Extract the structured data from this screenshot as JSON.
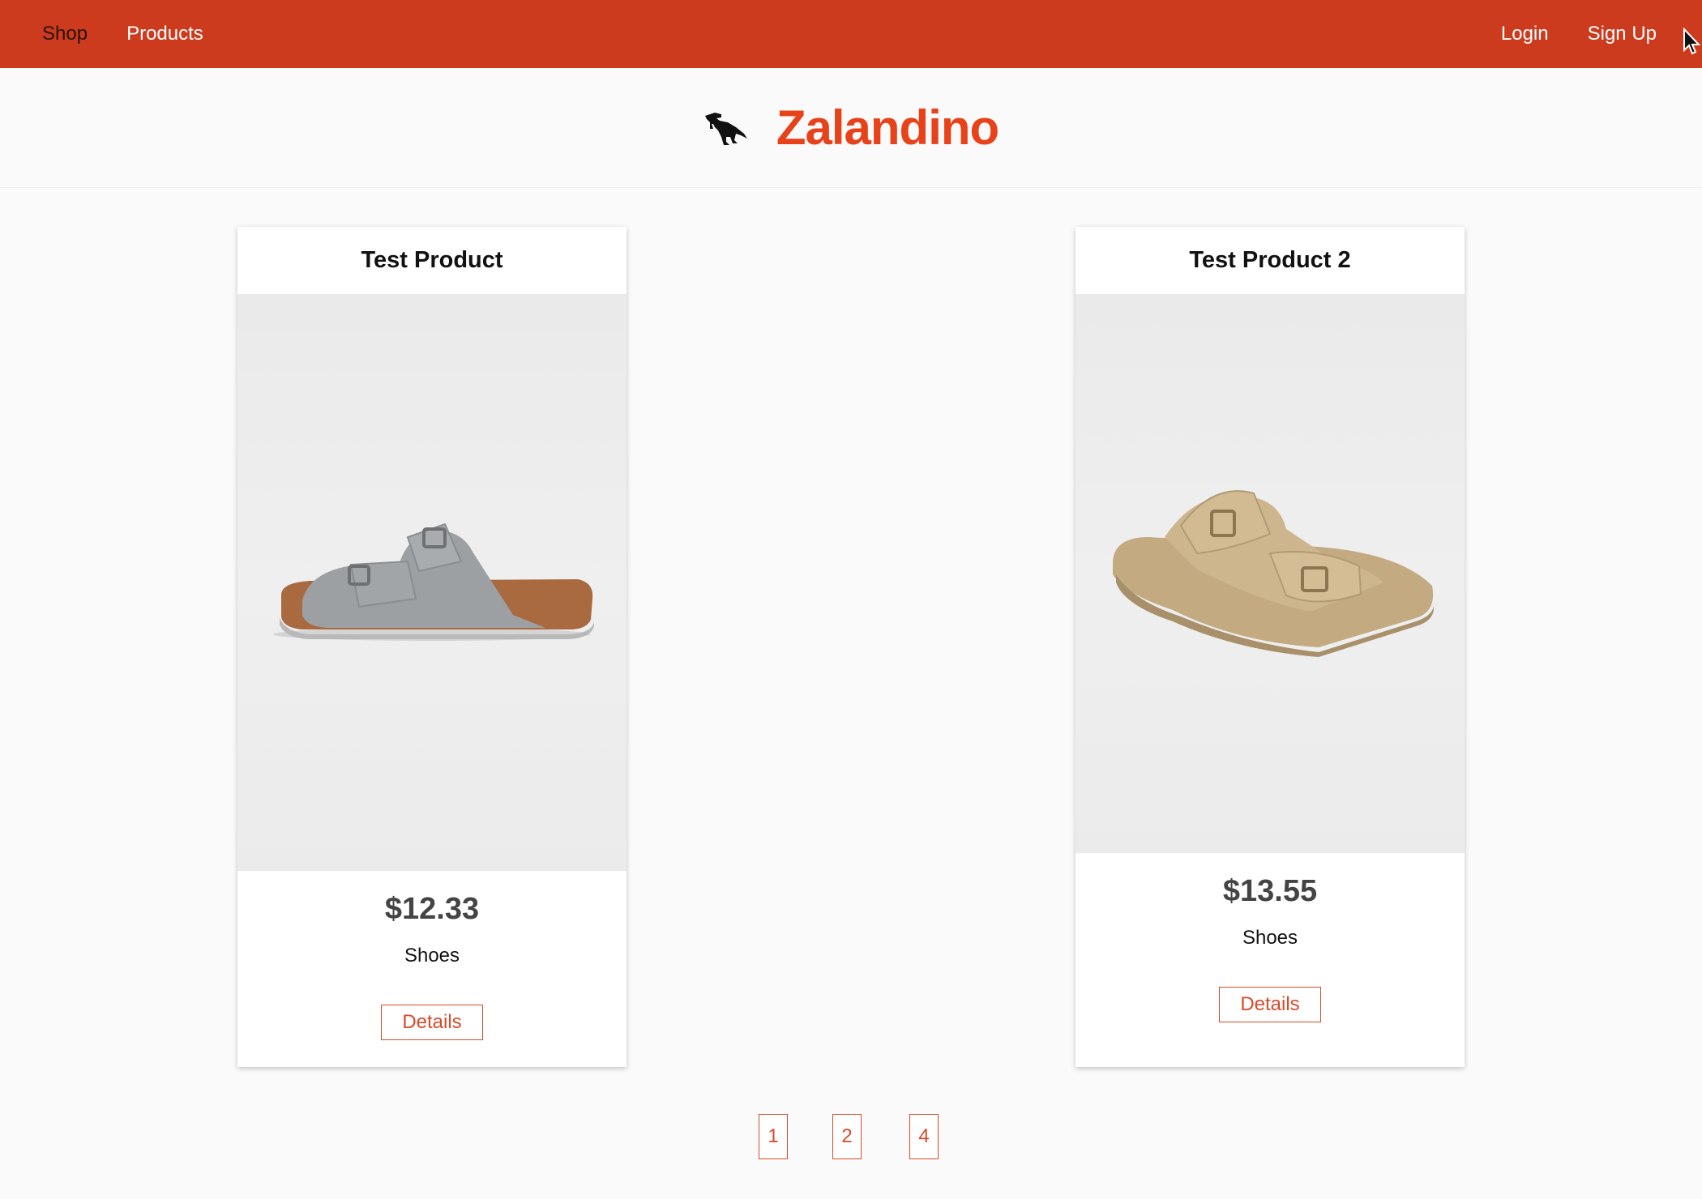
{
  "nav": {
    "left": [
      {
        "label": "Shop",
        "active": true
      },
      {
        "label": "Products",
        "active": false
      }
    ],
    "right": [
      {
        "label": "Login"
      },
      {
        "label": "Sign Up"
      }
    ]
  },
  "brand": {
    "name": "Zalandino",
    "logo_icon": "dinosaur-icon",
    "color": "#e8421a"
  },
  "theme": {
    "navbar_color": "#cc3b1e",
    "accent_color": "#d94a2a"
  },
  "products": [
    {
      "title": "Test Product",
      "price": "$12.33",
      "category": "Shoes",
      "details_label": "Details",
      "image": "grey-sandal"
    },
    {
      "title": "Test Product 2",
      "price": "$13.55",
      "category": "Shoes",
      "details_label": "Details",
      "image": "beige-sandal"
    }
  ],
  "pagination": {
    "pages": [
      "1",
      "2",
      "4"
    ]
  }
}
